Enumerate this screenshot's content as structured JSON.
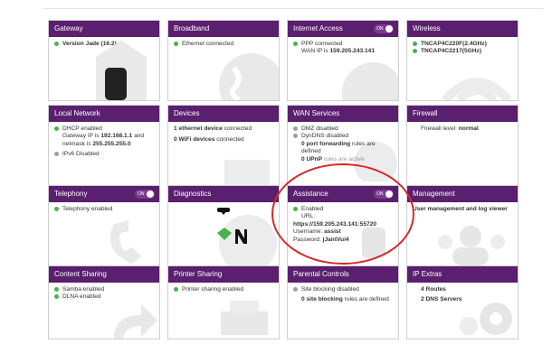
{
  "tiles": {
    "gateway": {
      "title": "Gateway",
      "lines": [
        "Version Jade (16.2)"
      ]
    },
    "broadband": {
      "title": "Broadband",
      "lines": [
        "Ethernet connected"
      ]
    },
    "internet": {
      "title": "Internet Access",
      "toggle": "ON",
      "l1": "PPP connected",
      "l2_prefix": "WAN IP is ",
      "l2_value": "159.205.243.141"
    },
    "wireless": {
      "title": "Wireless",
      "lines": [
        "TNCAP4C220F(2.4GHz)",
        "TNCAP4C2217(5GHz)"
      ]
    },
    "localnet": {
      "title": "Local Network",
      "l1": "DHCP enabled",
      "l2_prefix": "Gateway IP is ",
      "l2_value": "192.168.1.1",
      "l2_suffix": " and",
      "l3_prefix": "netmask is ",
      "l3_value": "255.255.255.0",
      "l4": "IPv6 Disabled"
    },
    "devices": {
      "title": "Devices",
      "l1_value": "1 ethernet device",
      "l1_suffix": " connected",
      "l2_value": "0 WiFi devices",
      "l2_suffix": " connected"
    },
    "wan": {
      "title": "WAN Services",
      "l1": "DMZ disabled",
      "l2": "DynDNS disabled",
      "l3_value": "0 port forwarding",
      "l3_suffix": " rules are defined",
      "l4_value": "0 UPnP",
      "l4_suffix": " rules are active"
    },
    "firewall": {
      "title": "Firewall",
      "label": "Firewall level: ",
      "value": "normal"
    },
    "telephony": {
      "title": "Telephony",
      "toggle": "ON",
      "lines": [
        "Telephony enabled"
      ]
    },
    "diagnostics": {
      "title": "Diagnostics"
    },
    "assistance": {
      "title": "Assistance",
      "toggle": "ON",
      "l1": "Enabled",
      "l2": "URL:",
      "l3_value": "https://159.205.243.141:55720",
      "l4_prefix": "Username: ",
      "l4_value": "assist",
      "l5_prefix": "Password: ",
      "l5_value": "jJantVui4"
    },
    "management": {
      "title": "Management",
      "value": "User management and log viewer"
    },
    "content": {
      "title": "Content Sharing",
      "lines": [
        "Samba enabled",
        "DLNA enabled"
      ]
    },
    "printer": {
      "title": "Printer Sharing",
      "lines": [
        "Printer sharing enabled"
      ]
    },
    "parental": {
      "title": "Parental Controls",
      "l1": "Site blocking disabled",
      "l2_value": "0 site blocking",
      "l2_suffix": " rules are defined"
    },
    "ipextras": {
      "title": "IP Extras",
      "l1": "4 Routes",
      "l2": "2 DNS Servers"
    }
  },
  "colors": {
    "header": "#5a1f6e",
    "ok": "#4caf50",
    "off": "#9e9e9e",
    "highlight": "#d42a2a"
  }
}
